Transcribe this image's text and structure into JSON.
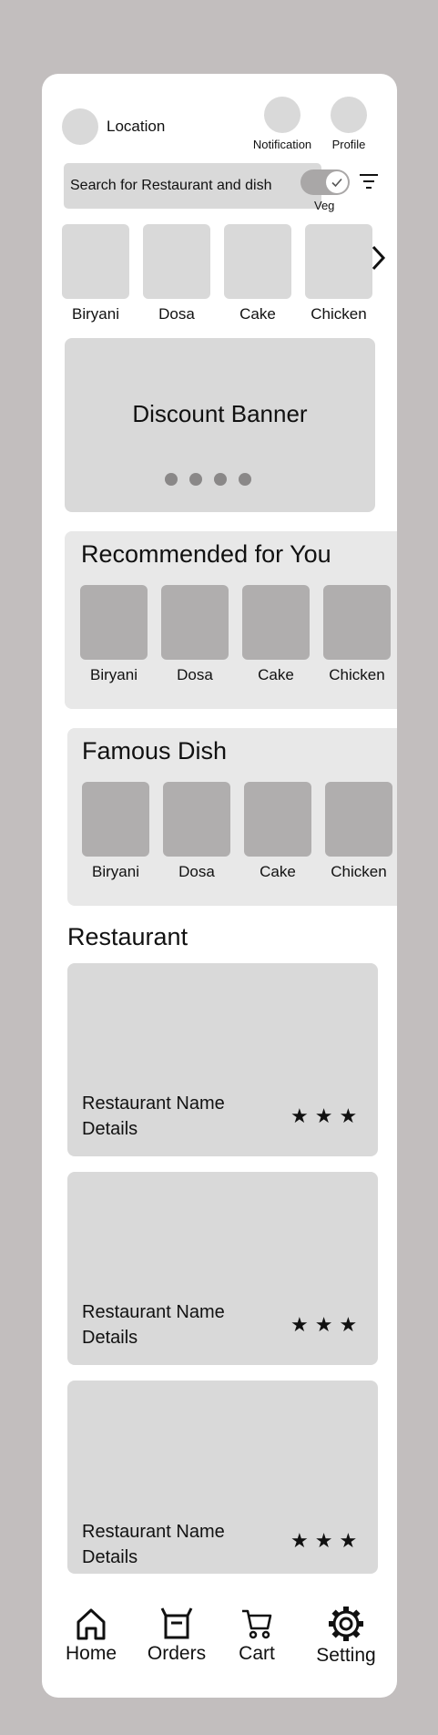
{
  "header": {
    "location_label": "Location",
    "notification_label": "Notification",
    "profile_label": "Profile"
  },
  "search": {
    "placeholder": "Search for Restaurant and dish",
    "veg_label": "Veg",
    "veg_on": true
  },
  "categories": [
    {
      "label": "Biryani"
    },
    {
      "label": "Dosa"
    },
    {
      "label": "Cake"
    },
    {
      "label": "Chicken"
    }
  ],
  "banner": {
    "title": "Discount Banner",
    "slides": 4
  },
  "recommended": {
    "title": "Recommended for You",
    "items": [
      {
        "label": "Biryani"
      },
      {
        "label": "Dosa"
      },
      {
        "label": "Cake"
      },
      {
        "label": "Chicken"
      }
    ]
  },
  "famous": {
    "title": "Famous Dish",
    "items": [
      {
        "label": "Biryani"
      },
      {
        "label": "Dosa"
      },
      {
        "label": "Cake"
      },
      {
        "label": "Chicken"
      }
    ]
  },
  "restaurants": {
    "title": "Restaurant",
    "cards": [
      {
        "name": "Restaurant Name",
        "details": "Details",
        "rating": 3
      },
      {
        "name": "Restaurant Name",
        "details": "Details",
        "rating": 3
      },
      {
        "name": "Restaurant Name",
        "details": "Details",
        "rating": 3
      }
    ]
  },
  "bottom_nav": {
    "home": "Home",
    "orders": "Orders",
    "cart": "Cart",
    "setting": "Setting"
  },
  "colors": {
    "background": "#c2bebe",
    "placeholder_fill": "#d9d9d9",
    "section_fill": "#e8e8e8",
    "dark_tile": "#b0aeae"
  }
}
